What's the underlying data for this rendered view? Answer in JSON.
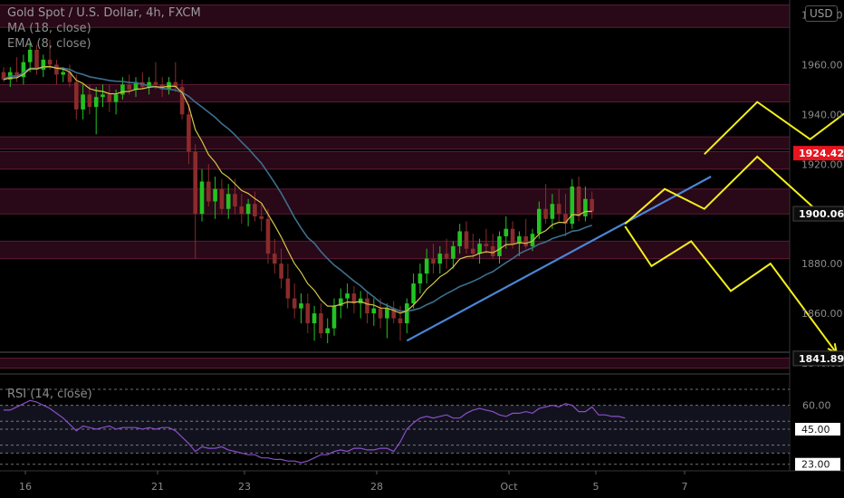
{
  "header": {
    "title": "Gold Spot / U.S. Dollar, 4h, FXCM",
    "indicator_ma": "MA (18, close)",
    "indicator_ema": "EMA (8, close)",
    "currency_button": "USD",
    "rsi_label": "RSI (14, close)"
  },
  "colors": {
    "background": "#000000",
    "bull": "#22c322",
    "bear": "#8b2b2b",
    "ma": "#3d6f8e",
    "ema": "#d4c64a",
    "trendline": "#4a86d6",
    "projection": "#f4ee1c",
    "resistance_zone": "#4a0f2a",
    "rsi_line": "#8a4fc8",
    "rsi_band": "#12121e",
    "axis_text": "#8b8b8b",
    "price_tag_red": "#e8141e",
    "price_tag_dark": "#0d0d0d"
  },
  "chart_data": {
    "type": "candlestick",
    "title": "Gold Spot / U.S. Dollar, 4h, FXCM",
    "price_axis": {
      "ticks": [
        "1980.00",
        "1960.00",
        "1940.00",
        "1920.00",
        "1900.00",
        "1880.00",
        "1860.00",
        "1840.00"
      ],
      "tick_values": [
        1980,
        1960,
        1940,
        1920,
        1900,
        1880,
        1860,
        1840
      ],
      "range": [
        1836,
        1986
      ]
    },
    "time_axis": {
      "labels": [
        "16",
        "21",
        "23",
        "28",
        "Oct",
        "5",
        "7"
      ]
    },
    "price_tags": [
      {
        "text": "1924.42",
        "value": 1924.42,
        "style": "red"
      },
      {
        "text": "1900.06",
        "value": 1900.06,
        "style": "dark"
      },
      {
        "text": "1841.89",
        "value": 1841.89,
        "style": "dark"
      }
    ],
    "resistance_zones": [
      {
        "from": 1975,
        "to": 1984
      },
      {
        "from": 1945,
        "to": 1952
      },
      {
        "from": 1926,
        "to": 1931
      },
      {
        "from": 1918,
        "to": 1925
      },
      {
        "from": 1900,
        "to": 1910
      },
      {
        "from": 1882,
        "to": 1889
      },
      {
        "from": 1838,
        "to": 1842
      }
    ],
    "candles": [
      {
        "o": 1957,
        "h": 1959,
        "l": 1953,
        "c": 1954
      },
      {
        "o": 1954,
        "h": 1959,
        "l": 1951,
        "c": 1957
      },
      {
        "o": 1957,
        "h": 1963,
        "l": 1953,
        "c": 1955
      },
      {
        "o": 1955,
        "h": 1964,
        "l": 1952,
        "c": 1961
      },
      {
        "o": 1961,
        "h": 1969,
        "l": 1957,
        "c": 1966
      },
      {
        "o": 1966,
        "h": 1968,
        "l": 1956,
        "c": 1958
      },
      {
        "o": 1958,
        "h": 1964,
        "l": 1955,
        "c": 1962
      },
      {
        "o": 1962,
        "h": 1970,
        "l": 1958,
        "c": 1960
      },
      {
        "o": 1960,
        "h": 1962,
        "l": 1952,
        "c": 1956
      },
      {
        "o": 1956,
        "h": 1959,
        "l": 1953,
        "c": 1957
      },
      {
        "o": 1957,
        "h": 1960,
        "l": 1951,
        "c": 1953
      },
      {
        "o": 1953,
        "h": 1956,
        "l": 1938,
        "c": 1942
      },
      {
        "o": 1942,
        "h": 1952,
        "l": 1938,
        "c": 1948
      },
      {
        "o": 1948,
        "h": 1952,
        "l": 1940,
        "c": 1943
      },
      {
        "o": 1943,
        "h": 1951,
        "l": 1932,
        "c": 1947
      },
      {
        "o": 1947,
        "h": 1952,
        "l": 1943,
        "c": 1948
      },
      {
        "o": 1948,
        "h": 1952,
        "l": 1941,
        "c": 1945
      },
      {
        "o": 1945,
        "h": 1950,
        "l": 1940,
        "c": 1948
      },
      {
        "o": 1948,
        "h": 1955,
        "l": 1946,
        "c": 1952
      },
      {
        "o": 1952,
        "h": 1956,
        "l": 1948,
        "c": 1950
      },
      {
        "o": 1950,
        "h": 1955,
        "l": 1947,
        "c": 1953
      },
      {
        "o": 1953,
        "h": 1957,
        "l": 1950,
        "c": 1951
      },
      {
        "o": 1951,
        "h": 1955,
        "l": 1948,
        "c": 1953
      },
      {
        "o": 1953,
        "h": 1961,
        "l": 1950,
        "c": 1952
      },
      {
        "o": 1952,
        "h": 1955,
        "l": 1947,
        "c": 1950
      },
      {
        "o": 1950,
        "h": 1955,
        "l": 1948,
        "c": 1953
      },
      {
        "o": 1953,
        "h": 1961,
        "l": 1949,
        "c": 1951
      },
      {
        "o": 1951,
        "h": 1954,
        "l": 1938,
        "c": 1940
      },
      {
        "o": 1940,
        "h": 1944,
        "l": 1920,
        "c": 1925
      },
      {
        "o": 1925,
        "h": 1928,
        "l": 1882,
        "c": 1900
      },
      {
        "o": 1900,
        "h": 1918,
        "l": 1897,
        "c": 1913
      },
      {
        "o": 1913,
        "h": 1920,
        "l": 1903,
        "c": 1905
      },
      {
        "o": 1905,
        "h": 1915,
        "l": 1898,
        "c": 1910
      },
      {
        "o": 1910,
        "h": 1914,
        "l": 1900,
        "c": 1902
      },
      {
        "o": 1902,
        "h": 1912,
        "l": 1898,
        "c": 1908
      },
      {
        "o": 1908,
        "h": 1914,
        "l": 1900,
        "c": 1903
      },
      {
        "o": 1903,
        "h": 1908,
        "l": 1896,
        "c": 1900
      },
      {
        "o": 1900,
        "h": 1906,
        "l": 1895,
        "c": 1904
      },
      {
        "o": 1904,
        "h": 1909,
        "l": 1897,
        "c": 1899
      },
      {
        "o": 1899,
        "h": 1904,
        "l": 1893,
        "c": 1898
      },
      {
        "o": 1898,
        "h": 1902,
        "l": 1880,
        "c": 1884
      },
      {
        "o": 1884,
        "h": 1890,
        "l": 1876,
        "c": 1880
      },
      {
        "o": 1880,
        "h": 1886,
        "l": 1870,
        "c": 1874
      },
      {
        "o": 1874,
        "h": 1880,
        "l": 1862,
        "c": 1866
      },
      {
        "o": 1866,
        "h": 1872,
        "l": 1858,
        "c": 1862
      },
      {
        "o": 1862,
        "h": 1868,
        "l": 1856,
        "c": 1864
      },
      {
        "o": 1864,
        "h": 1868,
        "l": 1852,
        "c": 1856
      },
      {
        "o": 1856,
        "h": 1863,
        "l": 1849,
        "c": 1860
      },
      {
        "o": 1860,
        "h": 1864,
        "l": 1850,
        "c": 1852
      },
      {
        "o": 1852,
        "h": 1858,
        "l": 1848,
        "c": 1854
      },
      {
        "o": 1854,
        "h": 1866,
        "l": 1851,
        "c": 1863
      },
      {
        "o": 1863,
        "h": 1870,
        "l": 1858,
        "c": 1866
      },
      {
        "o": 1866,
        "h": 1872,
        "l": 1862,
        "c": 1868
      },
      {
        "o": 1868,
        "h": 1871,
        "l": 1860,
        "c": 1864
      },
      {
        "o": 1864,
        "h": 1869,
        "l": 1858,
        "c": 1866
      },
      {
        "o": 1866,
        "h": 1869,
        "l": 1856,
        "c": 1860
      },
      {
        "o": 1860,
        "h": 1866,
        "l": 1855,
        "c": 1862
      },
      {
        "o": 1862,
        "h": 1866,
        "l": 1854,
        "c": 1858
      },
      {
        "o": 1858,
        "h": 1864,
        "l": 1850,
        "c": 1862
      },
      {
        "o": 1862,
        "h": 1865,
        "l": 1856,
        "c": 1858
      },
      {
        "o": 1858,
        "h": 1863,
        "l": 1849,
        "c": 1856
      },
      {
        "o": 1856,
        "h": 1866,
        "l": 1852,
        "c": 1864
      },
      {
        "o": 1864,
        "h": 1876,
        "l": 1862,
        "c": 1872
      },
      {
        "o": 1872,
        "h": 1880,
        "l": 1868,
        "c": 1876
      },
      {
        "o": 1876,
        "h": 1886,
        "l": 1872,
        "c": 1882
      },
      {
        "o": 1882,
        "h": 1888,
        "l": 1876,
        "c": 1880
      },
      {
        "o": 1880,
        "h": 1887,
        "l": 1876,
        "c": 1884
      },
      {
        "o": 1884,
        "h": 1890,
        "l": 1878,
        "c": 1882
      },
      {
        "o": 1882,
        "h": 1889,
        "l": 1878,
        "c": 1887
      },
      {
        "o": 1887,
        "h": 1896,
        "l": 1884,
        "c": 1893
      },
      {
        "o": 1893,
        "h": 1897,
        "l": 1884,
        "c": 1886
      },
      {
        "o": 1886,
        "h": 1892,
        "l": 1882,
        "c": 1884
      },
      {
        "o": 1884,
        "h": 1890,
        "l": 1880,
        "c": 1888
      },
      {
        "o": 1888,
        "h": 1894,
        "l": 1884,
        "c": 1887
      },
      {
        "o": 1887,
        "h": 1892,
        "l": 1882,
        "c": 1883
      },
      {
        "o": 1883,
        "h": 1893,
        "l": 1880,
        "c": 1891
      },
      {
        "o": 1891,
        "h": 1899,
        "l": 1886,
        "c": 1894
      },
      {
        "o": 1894,
        "h": 1897,
        "l": 1886,
        "c": 1888
      },
      {
        "o": 1888,
        "h": 1893,
        "l": 1883,
        "c": 1891
      },
      {
        "o": 1891,
        "h": 1898,
        "l": 1886,
        "c": 1887
      },
      {
        "o": 1887,
        "h": 1894,
        "l": 1885,
        "c": 1892
      },
      {
        "o": 1892,
        "h": 1905,
        "l": 1890,
        "c": 1902
      },
      {
        "o": 1902,
        "h": 1912,
        "l": 1896,
        "c": 1898
      },
      {
        "o": 1898,
        "h": 1908,
        "l": 1894,
        "c": 1904
      },
      {
        "o": 1904,
        "h": 1910,
        "l": 1897,
        "c": 1900
      },
      {
        "o": 1900,
        "h": 1908,
        "l": 1891,
        "c": 1896
      },
      {
        "o": 1896,
        "h": 1914,
        "l": 1894,
        "c": 1911
      },
      {
        "o": 1911,
        "h": 1915,
        "l": 1897,
        "c": 1899
      },
      {
        "o": 1899,
        "h": 1911,
        "l": 1897,
        "c": 1906
      },
      {
        "o": 1906,
        "h": 1909,
        "l": 1898,
        "c": 1901
      }
    ],
    "ma18_close": {
      "label": "MA (18, close)"
    },
    "ema8_close": {
      "label": "EMA (8, close)"
    },
    "trendline": {
      "from": {
        "bar": 61,
        "value": 1849
      },
      "to": {
        "bar": 107,
        "value": 1915
      }
    },
    "projections": [
      {
        "path": [
          [
            94,
            1896
          ],
          [
            100,
            1910
          ],
          [
            106,
            1902
          ],
          [
            114,
            1923
          ],
          [
            124,
            1899
          ]
        ]
      },
      {
        "path": [
          [
            106,
            1924
          ],
          [
            114,
            1945
          ],
          [
            122,
            1930
          ],
          [
            134,
            1954
          ]
        ]
      },
      {
        "path": [
          [
            94,
            1895
          ],
          [
            98,
            1879
          ],
          [
            104,
            1889
          ],
          [
            110,
            1869
          ],
          [
            116,
            1880
          ],
          [
            126,
            1844
          ]
        ]
      }
    ],
    "rsi": {
      "label": "RSI (14, close)",
      "levels": [
        70,
        60,
        50,
        45,
        35,
        30,
        23
      ],
      "tick_labels": [
        "60.00",
        "45.00",
        "23.00"
      ],
      "values": [
        57,
        57,
        59,
        61,
        63,
        62,
        60,
        58,
        55,
        52,
        48,
        44,
        47,
        46,
        45,
        46,
        47,
        45,
        46,
        46,
        46,
        45,
        46,
        45,
        46,
        46,
        44,
        40,
        36,
        31,
        34,
        33,
        33,
        34,
        32,
        31,
        30,
        29,
        29,
        27,
        27,
        26,
        26,
        25,
        25,
        24,
        25,
        27,
        29,
        29,
        31,
        32,
        31,
        33,
        33,
        32,
        32,
        33,
        33,
        31,
        37,
        45,
        49,
        52,
        53,
        52,
        53,
        54,
        52,
        52,
        55,
        57,
        58,
        57,
        56,
        54,
        53,
        55,
        55,
        56,
        55,
        58,
        59,
        60,
        59,
        61,
        60,
        56,
        56,
        59,
        54,
        54,
        53,
        53,
        52
      ]
    }
  }
}
